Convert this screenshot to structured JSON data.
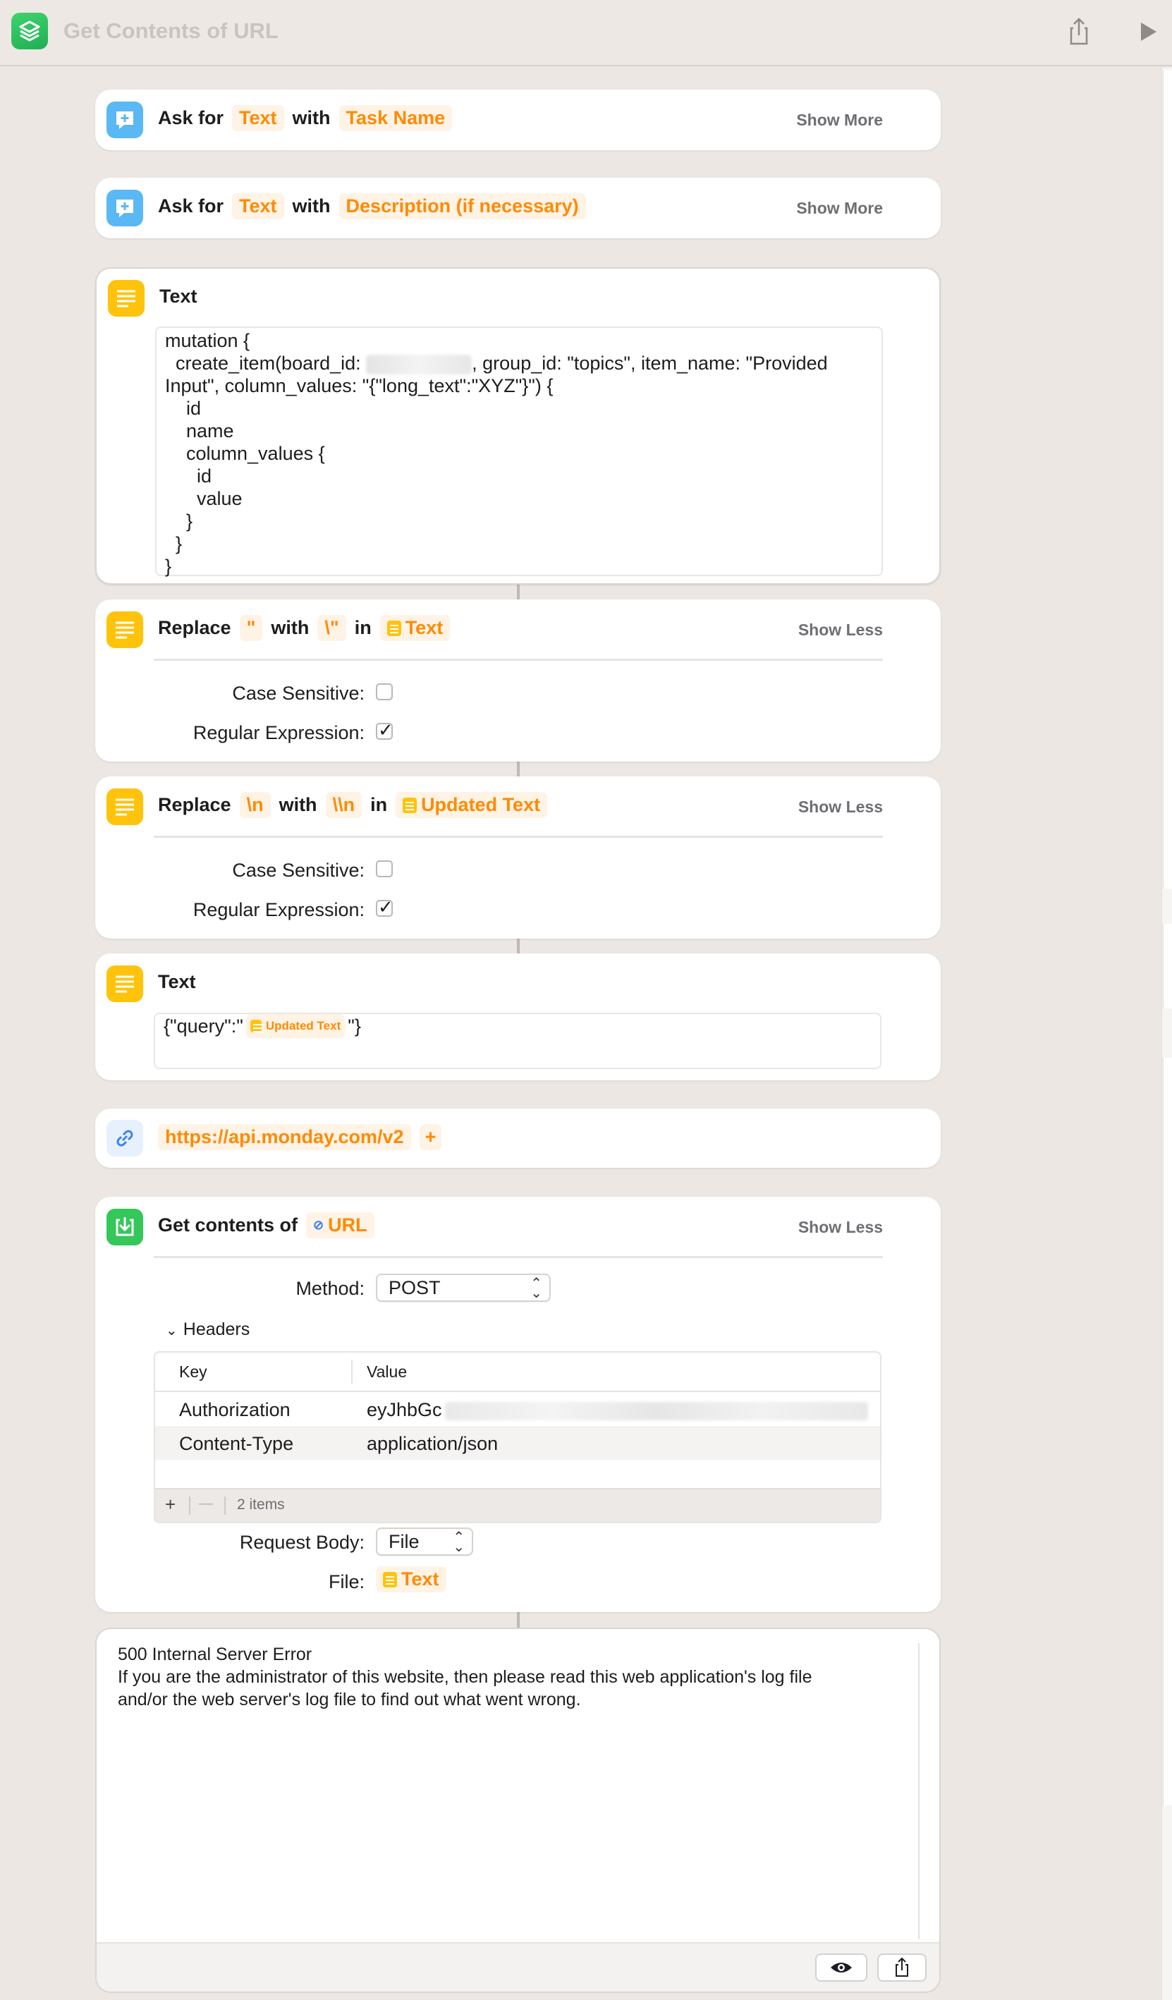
{
  "window": {
    "title": "Get Contents of URL"
  },
  "actions": {
    "ask1": {
      "verb": "Ask for",
      "type_token": "Text",
      "with": "with",
      "prompt_token": "Task Name",
      "toggle": "Show More"
    },
    "ask2": {
      "verb": "Ask for",
      "type_token": "Text",
      "with": "with",
      "prompt_token": "Description (if necessary)",
      "toggle": "Show More"
    },
    "text1": {
      "title": "Text",
      "lines": [
        "mutation {",
        "  create_item(board_id: ",
        "Input\", column_values: \"{\"long_text\":\"XYZ\"}\") {",
        "    id",
        "    name",
        "    column_values {",
        "      id",
        "      value",
        "    }",
        "  }",
        "}"
      ],
      "line2_tail": ", group_id: \"topics\", item_name: \"Provided"
    },
    "replace1": {
      "verb": "Replace",
      "find": "\"",
      "with": "with",
      "replace": "\\\"",
      "in": "in",
      "target": "Text",
      "toggle": "Show Less",
      "case_label": "Case Sensitive:",
      "regex_label": "Regular Expression:",
      "case_checked": false,
      "regex_checked": true
    },
    "replace2": {
      "verb": "Replace",
      "find": "\\n",
      "with": "with",
      "replace": "\\\\n",
      "in": "in",
      "target": "Updated Text",
      "toggle": "Show Less",
      "case_label": "Case Sensitive:",
      "regex_label": "Regular Expression:",
      "case_checked": false,
      "regex_checked": true
    },
    "text2": {
      "title": "Text",
      "prefix": "{\"query\":\"",
      "token": "Updated Text",
      "suffix": "\"}"
    },
    "url": {
      "value": "https://api.monday.com/v2",
      "add": "+"
    },
    "get": {
      "title": "Get contents of",
      "token": "URL",
      "toggle": "Show Less",
      "method_label": "Method:",
      "method_value": "POST",
      "headers_label": "Headers",
      "col_key": "Key",
      "col_value": "Value",
      "rows": [
        {
          "key": "Authorization",
          "value": "eyJhbGc"
        },
        {
          "key": "Content-Type",
          "value": "application/json"
        }
      ],
      "add": "+",
      "remove": "—",
      "count": "2 items",
      "body_label": "Request Body:",
      "body_value": "File",
      "file_label": "File:",
      "file_token": "Text"
    }
  },
  "result": {
    "line1": "500 Internal Server Error",
    "line2": "If you are the administrator of this website, then please read this web application's log file",
    "line3": "and/or the web server's log file to find out what went wrong."
  },
  "colors": {
    "token_orange": "#ff8a00",
    "token_bg": "#fff3e6",
    "ask_blue": "#5ab8f4",
    "text_yellow": "#ffc30b",
    "get_green": "#34c759"
  },
  "icons": [
    "shortcuts-app-icon",
    "share-icon",
    "play-icon",
    "ask-for-input-icon",
    "text-icon",
    "url-link-icon",
    "download-icon",
    "eye-icon"
  ]
}
